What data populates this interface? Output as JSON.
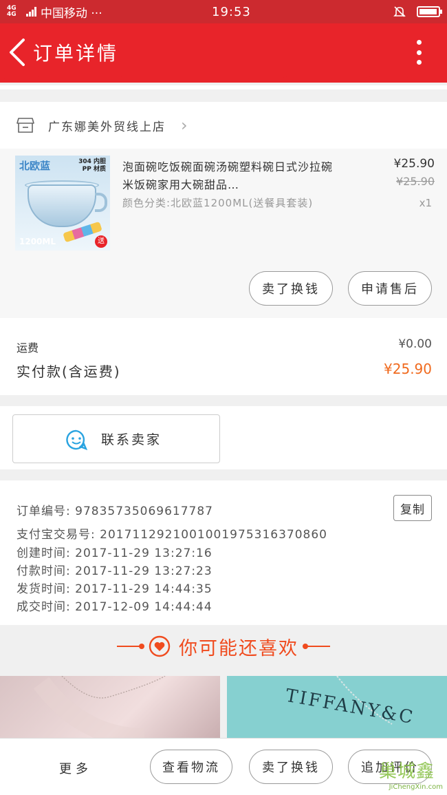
{
  "status_bar": {
    "network": "4G 4G",
    "carrier": "中国移动 ···",
    "time": "19:53"
  },
  "header": {
    "title": "订单详情"
  },
  "shop": {
    "name": "广东娜美外贸线上店"
  },
  "product": {
    "image_tag_left": "北欧蓝",
    "image_tag_right": "304 内胆 PP 材质",
    "image_tag_bottom": "1200ML",
    "image_gift": "送",
    "title": "泡面碗吃饭碗面碗汤碗塑料碗日式沙拉碗米饭碗家用大碗甜品…",
    "sku": "颜色分类:北欧蓝1200ML(送餐具套装)",
    "price": "¥25.90",
    "original_price": "¥25.90",
    "quantity": "x1",
    "btn_refund": "卖了换钱",
    "btn_after_sale": "申请售后"
  },
  "fees": {
    "shipping_label": "运费",
    "shipping_value": "¥0.00",
    "paid_label": "实付款(含运费)",
    "paid_value": "¥25.90"
  },
  "contact": {
    "label": "联系卖家"
  },
  "order_info": {
    "order_no": "订单编号: 97835735069617787",
    "copy": "复制",
    "alipay_no": "支付宝交易号: 2017112921001001975316370860",
    "created": "创建时间: 2017-11-29 13:27:16",
    "paid": "付款时间: 2017-11-29 13:27:23",
    "shipped": "发货时间: 2017-11-29 14:44:35",
    "completed": "成交时间: 2017-12-09 14:44:44"
  },
  "recommend": {
    "title": "你可能还喜欢",
    "brand_text": "TIFFANY&C"
  },
  "bottom_bar": {
    "more": "更多",
    "logistics": "查看物流",
    "sell": "卖了换钱",
    "review": "追加评价"
  },
  "watermark": {
    "logo": "巢城鑫",
    "url": "JiChengXin.com"
  },
  "colors": {
    "header_red": "#e8242a",
    "status_red": "#cc2a2f",
    "price_orange": "#f06a1e",
    "accent_orange": "#f04b1e",
    "chat_blue": "#29a3e0"
  }
}
